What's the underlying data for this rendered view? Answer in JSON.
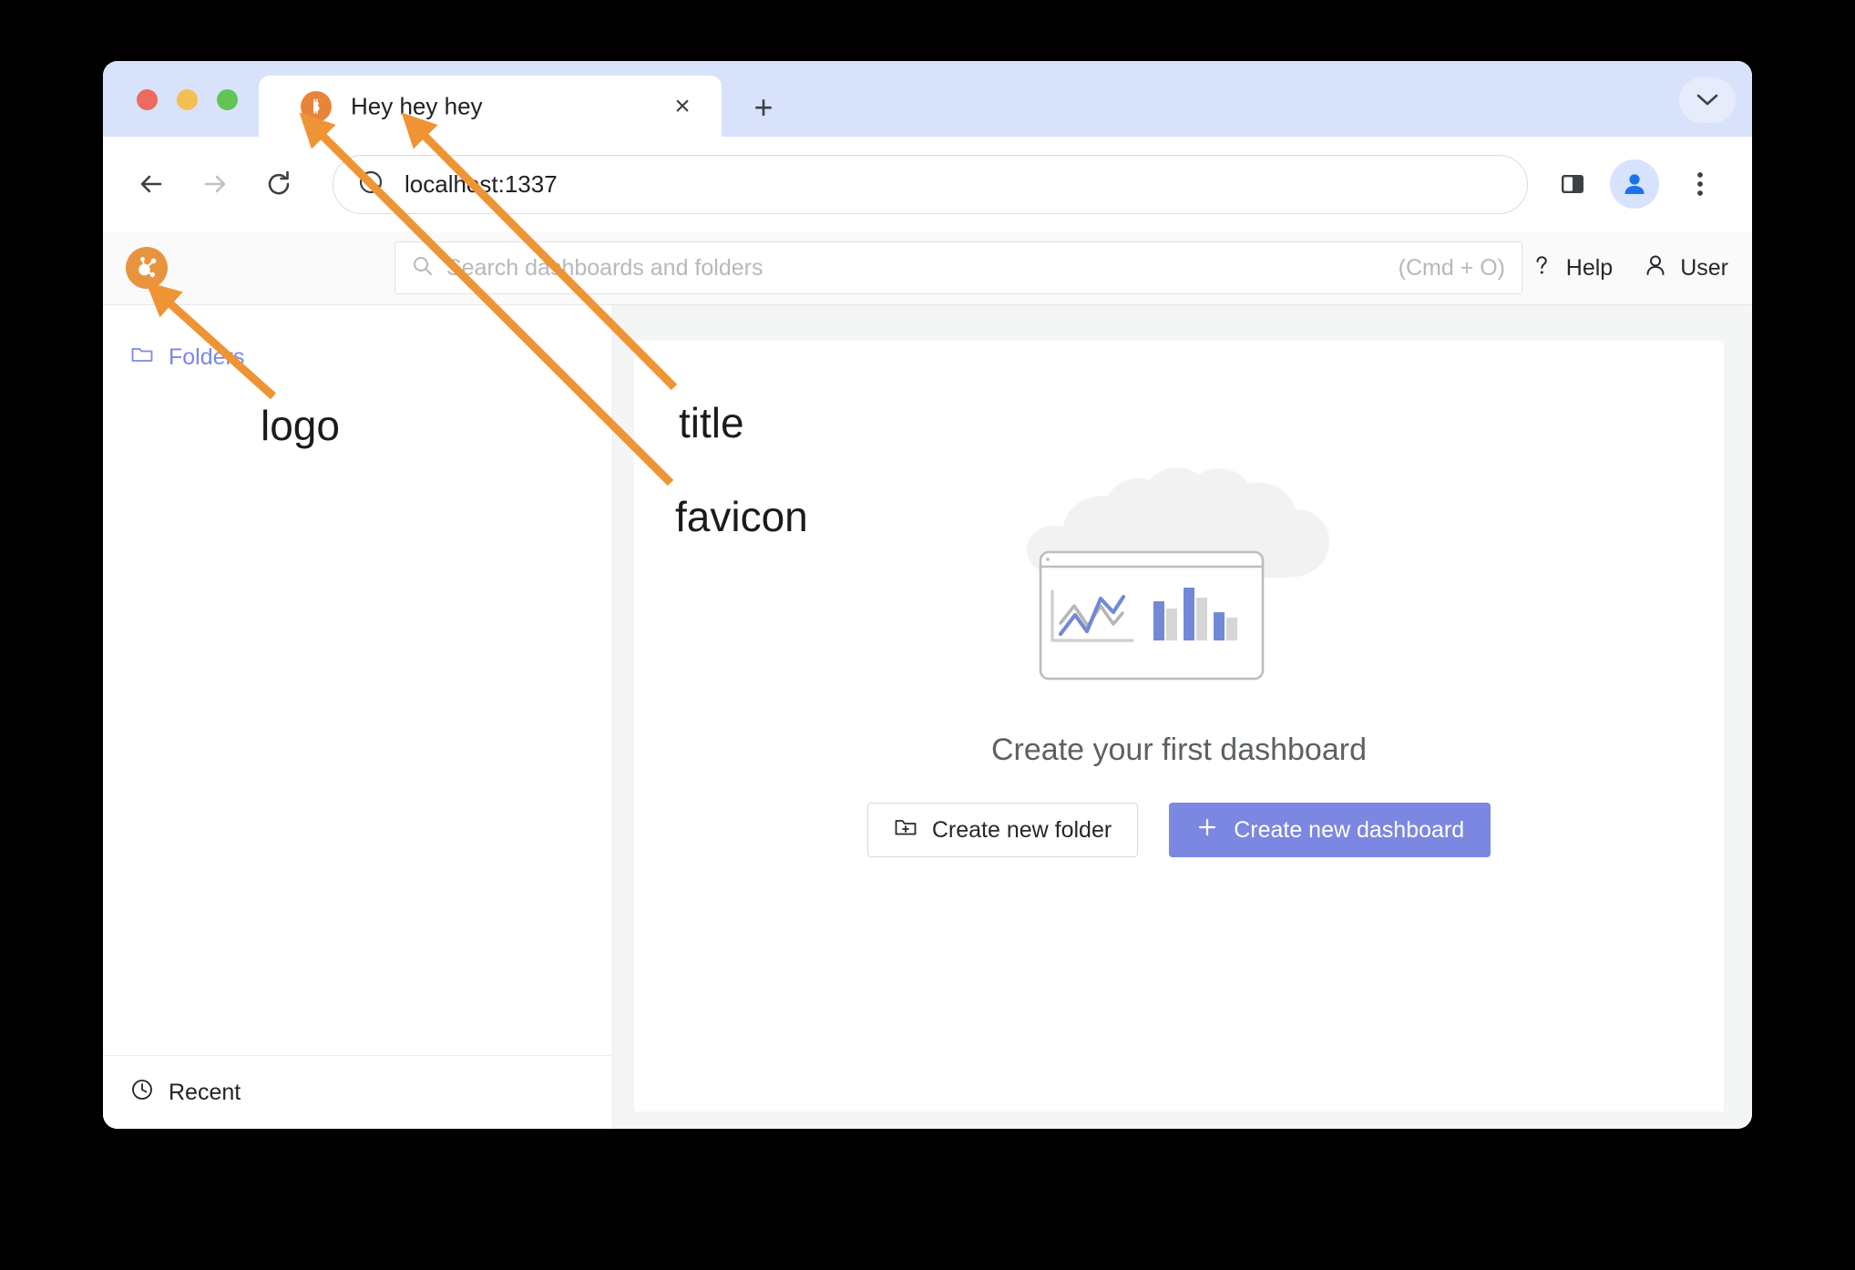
{
  "browser": {
    "tab": {
      "title": "Hey hey hey",
      "favicon_icon": "bitcoin-b-icon",
      "close_label": "×",
      "newtab_label": "+"
    },
    "toolbar": {
      "back_icon": "arrow-left-icon",
      "forward_icon": "arrow-right-icon",
      "reload_icon": "reload-icon",
      "site_icon": "globe-icon",
      "url": "localhost:1337",
      "side_panel_icon": "side-panel-icon",
      "profile_icon": "profile-avatar-icon",
      "menu_icon": "three-dot-menu-icon",
      "tabstrip_chevron_icon": "chevron-down-icon"
    }
  },
  "app": {
    "logo_icon": "grafana-logo-icon",
    "search": {
      "placeholder": "Search dashboards and folders",
      "shortcut": "(Cmd + O)",
      "icon": "search-icon"
    },
    "header_right": [
      {
        "label": "Help",
        "icon": "question-mark-icon"
      },
      {
        "label": "User",
        "icon": "user-icon"
      }
    ],
    "sidebar": {
      "folders": {
        "label": "Folders",
        "icon": "folder-icon"
      },
      "recent": {
        "label": "Recent",
        "icon": "clock-icon"
      }
    },
    "content": {
      "illustration": "dashboard-cloud-illustration",
      "title": "Create your first dashboard",
      "buttons": [
        {
          "label": "Create new folder",
          "icon": "folder-plus-icon",
          "style": "secondary"
        },
        {
          "label": "Create new dashboard",
          "icon": "plus-icon",
          "style": "primary"
        }
      ]
    }
  },
  "annotations": {
    "arrow_color": "#ef9435",
    "items": [
      {
        "label": "logo"
      },
      {
        "label": "title"
      },
      {
        "label": "favicon"
      }
    ]
  },
  "colors": {
    "tabstrip_bg": "#d8e2fb",
    "accent_orange": "#e8843a",
    "primary_button": "#7b87e0",
    "folder_link": "#7b87e8"
  }
}
